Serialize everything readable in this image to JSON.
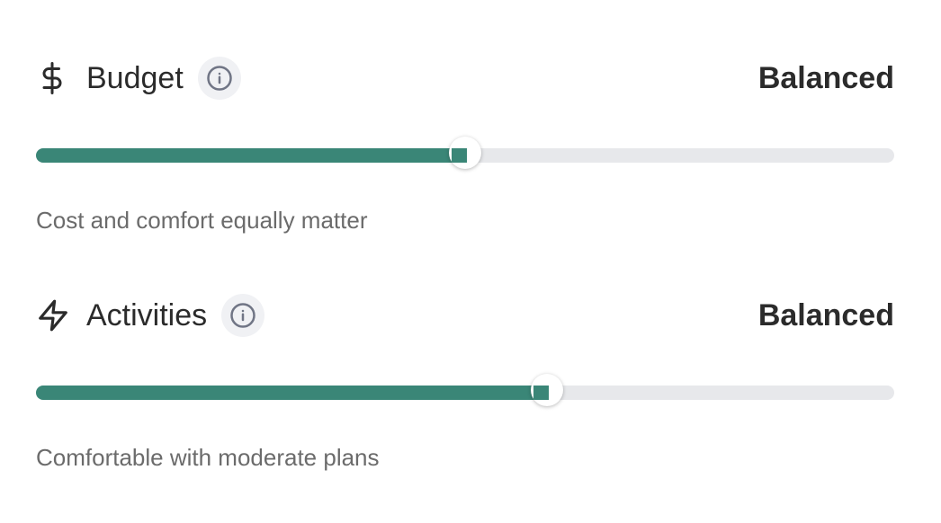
{
  "preferences": [
    {
      "icon": "dollar-sign-icon",
      "title": "Budget",
      "value": "Balanced",
      "description": "Cost and comfort equally matter",
      "slider_level": 0.5
    },
    {
      "icon": "lightning-bolt-icon",
      "title": "Activities",
      "value": "Balanced",
      "description": "Comfortable with moderate plans",
      "slider_level": 0.595
    }
  ],
  "colors": {
    "accent": "#3a8677",
    "track": "#e7e8eb",
    "text": "#2b2b2b",
    "muted": "#6b6b6b",
    "info_bg": "#f0f1f4"
  }
}
